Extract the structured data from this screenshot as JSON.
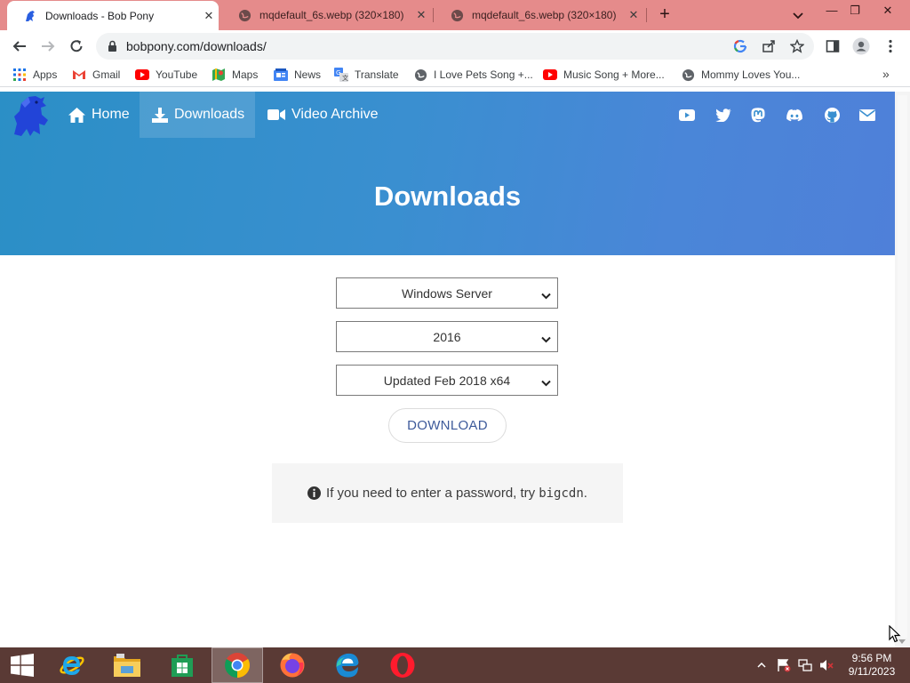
{
  "browser": {
    "tabs": [
      {
        "title": "Downloads - Bob Pony",
        "active": true
      },
      {
        "title": "mqdefault_6s.webp (320×180)",
        "active": false
      },
      {
        "title": "mqdefault_6s.webp (320×180)",
        "active": false
      }
    ],
    "new_tab": "+",
    "url": "bobpony.com/downloads/",
    "bookmarks": [
      {
        "label": "Apps",
        "icon": "apps-grid-icon"
      },
      {
        "label": "Gmail",
        "icon": "gmail-icon"
      },
      {
        "label": "YouTube",
        "icon": "youtube-icon"
      },
      {
        "label": "Maps",
        "icon": "maps-icon"
      },
      {
        "label": "News",
        "icon": "news-icon"
      },
      {
        "label": "Translate",
        "icon": "translate-icon"
      },
      {
        "label": "I Love Pets Song +...",
        "icon": "globe-icon"
      },
      {
        "label": "Music Song + More...",
        "icon": "youtube-icon"
      },
      {
        "label": "Mommy Loves You...",
        "icon": "globe-icon"
      }
    ],
    "bookmarks_overflow": "»"
  },
  "site": {
    "nav": [
      {
        "label": "Home",
        "icon": "home-icon",
        "active": false
      },
      {
        "label": "Downloads",
        "icon": "download-icon",
        "active": true
      },
      {
        "label": "Video Archive",
        "icon": "video-icon",
        "active": false
      }
    ],
    "social_icons": [
      "youtube-icon",
      "twitter-icon",
      "mastodon-icon",
      "discord-icon",
      "github-icon",
      "mail-icon"
    ],
    "page_title": "Downloads",
    "selects": [
      {
        "value": "Windows Server"
      },
      {
        "value": "2016"
      },
      {
        "value": "Updated Feb 2018 x64"
      }
    ],
    "download_label": "DOWNLOAD",
    "notice": {
      "text": "If you need to enter a password, try",
      "password": "bigcdn",
      "period": "."
    }
  },
  "taskbar": {
    "apps": [
      "start-icon",
      "internet-explorer-icon",
      "file-explorer-icon",
      "store-icon",
      "chrome-icon",
      "firefox-icon",
      "edge-icon",
      "opera-icon"
    ],
    "clock": {
      "time": "9:56 PM",
      "date": "9/11/2023"
    }
  },
  "colors": {
    "tabstrip": "#e58b8b",
    "hero_start": "#2b8fc6",
    "hero_end": "#4f80d9",
    "taskbar": "#5a3a35",
    "download_text": "#3d5a9a"
  }
}
